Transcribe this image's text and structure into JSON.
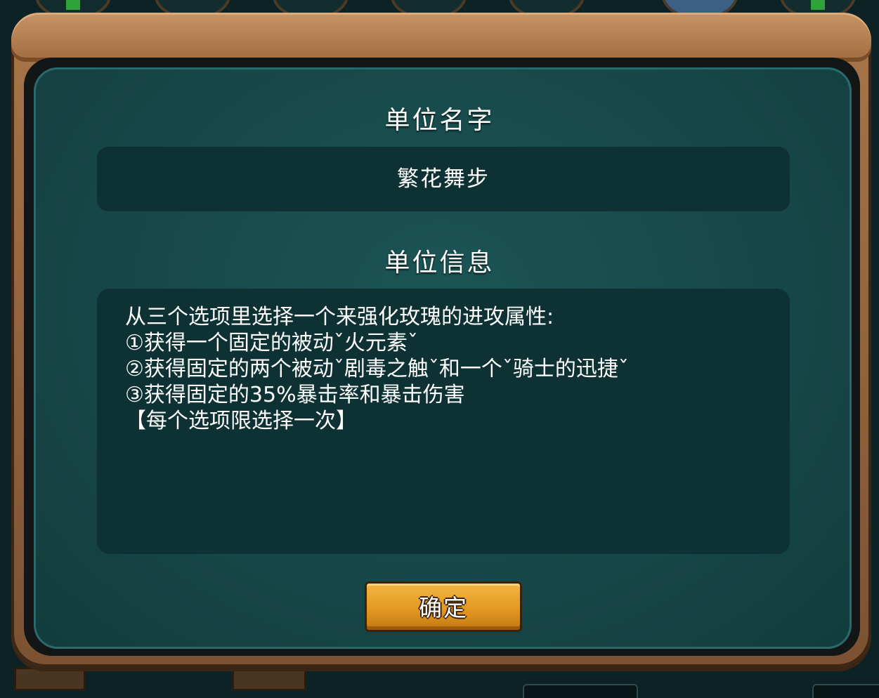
{
  "dialog": {
    "name_title": "单位名字",
    "name_value": "繁花舞步",
    "info_title": "单位信息",
    "info_lines": [
      "从三个选项里选择一个来强化玫瑰的进攻属性:",
      "①获得一个固定的被动ˇ火元素ˇ",
      "②获得固定的两个被动ˇ剧毒之触ˇ和一个ˇ骑士的迅捷ˇ",
      "③获得固定的35%暴击率和暴击伤害",
      "【每个选项限选择一次】"
    ],
    "confirm_label": "确定"
  },
  "colors": {
    "panel": "#174849",
    "text_box": "#0e3233",
    "frame_wood": "#a9754a",
    "button": "#e39a21"
  }
}
